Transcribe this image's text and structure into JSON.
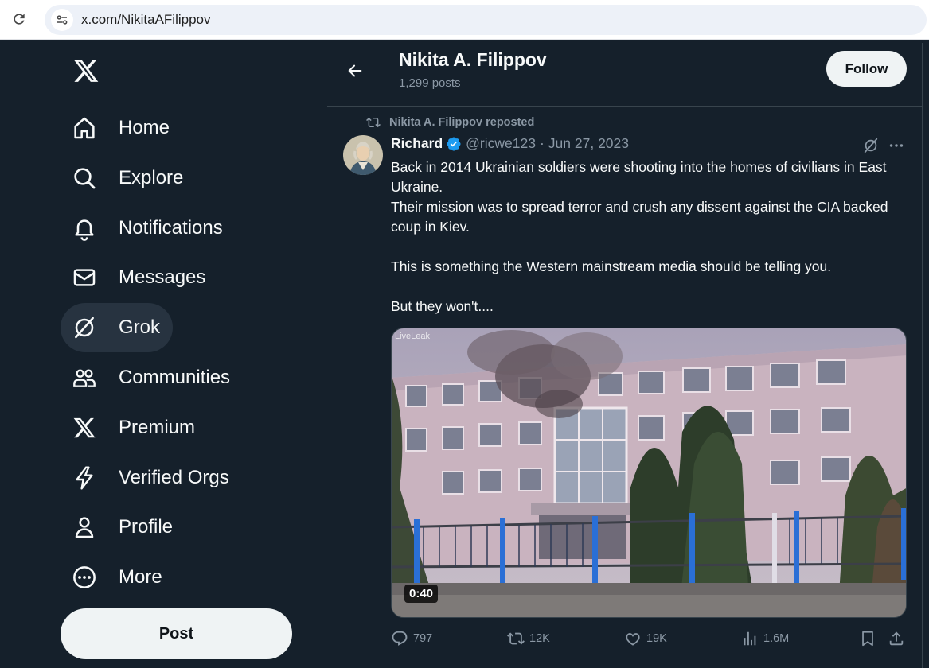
{
  "browser": {
    "url": "x.com/NikitaAFilippov"
  },
  "sidebar": {
    "items": [
      {
        "label": "Home",
        "icon": "home-icon"
      },
      {
        "label": "Explore",
        "icon": "search-icon"
      },
      {
        "label": "Notifications",
        "icon": "bell-icon"
      },
      {
        "label": "Messages",
        "icon": "envelope-icon"
      },
      {
        "label": "Grok",
        "icon": "grok-icon",
        "active": true
      },
      {
        "label": "Communities",
        "icon": "communities-icon"
      },
      {
        "label": "Premium",
        "icon": "x-logo-icon"
      },
      {
        "label": "Verified Orgs",
        "icon": "lightning-icon"
      },
      {
        "label": "Profile",
        "icon": "person-icon"
      },
      {
        "label": "More",
        "icon": "more-circle-icon"
      }
    ],
    "post_label": "Post"
  },
  "header": {
    "name": "Nikita A. Filippov",
    "post_count": "1,299 posts",
    "follow_label": "Follow"
  },
  "tweet": {
    "repost_label": "Nikita A. Filippov reposted",
    "author_name": "Richard",
    "handle": "@ricwe123",
    "separator": "·",
    "date": "Jun 27, 2023",
    "text_lines": [
      "Back in 2014 Ukrainian soldiers were shooting into the homes of civilians in East Ukraine.",
      "Their mission was to spread terror and crush any dissent against the CIA backed coup in Kiev.",
      "",
      "This is something the Western mainstream media should be telling you.",
      "",
      "But they won't...."
    ],
    "media": {
      "watermark": "LiveLeak",
      "duration": "0:40"
    },
    "stats": {
      "replies": "797",
      "reposts": "12K",
      "likes": "19K",
      "views": "1.6M"
    }
  },
  "colors": {
    "background": "#15202b",
    "accent": "#1d9bf0",
    "muted": "#8b98a5",
    "border": "#38444d"
  }
}
